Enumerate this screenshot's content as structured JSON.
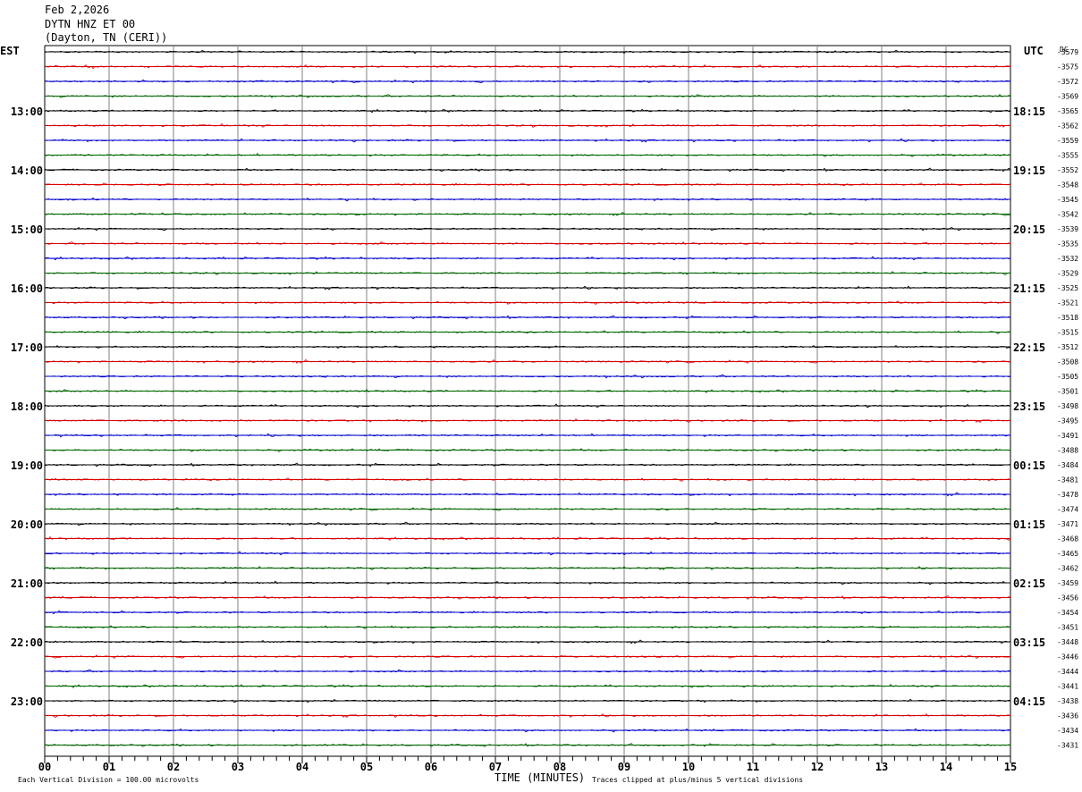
{
  "header": {
    "date": "Feb 2,2026",
    "station": "DYTN HNZ ET 00",
    "location": "(Dayton, TN (CERI))"
  },
  "left_zone_label": "EST",
  "right_zone_label": "UTC",
  "dc_label": "DC",
  "footer": {
    "scale_note": "Each Vertical Division =  100.00 microvolts",
    "xlabel": "TIME (MINUTES)",
    "clip_note": "Traces clipped at plus/minus 5 vertical divisions"
  },
  "colors": {
    "trace_cycle": [
      "#000000",
      "#dd0000",
      "#0000cc",
      "#006600"
    ],
    "grid": "#808080"
  },
  "chart_data": {
    "type": "line",
    "title": "DYTN HNZ ET 00",
    "xlabel": "TIME (MINUTES)",
    "ylabel": "",
    "xlim": [
      0,
      15
    ],
    "x_ticks": [
      "00",
      "01",
      "02",
      "03",
      "04",
      "05",
      "06",
      "07",
      "08",
      "09",
      "10",
      "11",
      "12",
      "13",
      "14",
      "15"
    ],
    "rows": 48,
    "left_time_labels": [
      "13:00",
      "14:00",
      "15:00",
      "16:00",
      "17:00",
      "18:00",
      "19:00",
      "20:00",
      "21:00",
      "22:00",
      "23:00"
    ],
    "right_time_labels": [
      "18:15",
      "19:15",
      "20:15",
      "21:15",
      "22:15",
      "23:15",
      "00:15",
      "01:15",
      "02:15",
      "03:15",
      "04:15"
    ],
    "dc_offsets": [
      "-3579",
      "-3575",
      "-3572",
      "-3569",
      "-3565",
      "-3562",
      "-3559",
      "-3555",
      "-3552",
      "-3548",
      "-3545",
      "-3542",
      "-3539",
      "-3535",
      "-3532",
      "-3529",
      "-3525",
      "-3521",
      "-3518",
      "-3515",
      "-3512",
      "-3508",
      "-3505",
      "-3501",
      "-3498",
      "-3495",
      "-3491",
      "-3488",
      "-3484",
      "-3481",
      "-3478",
      "-3474",
      "-3471",
      "-3468",
      "-3465",
      "-3462",
      "-3459",
      "-3456",
      "-3454",
      "-3451",
      "-3448",
      "-3446",
      "-3444",
      "-3441",
      "-3438",
      "-3436",
      "-3434",
      "-3431"
    ],
    "grid": true
  }
}
